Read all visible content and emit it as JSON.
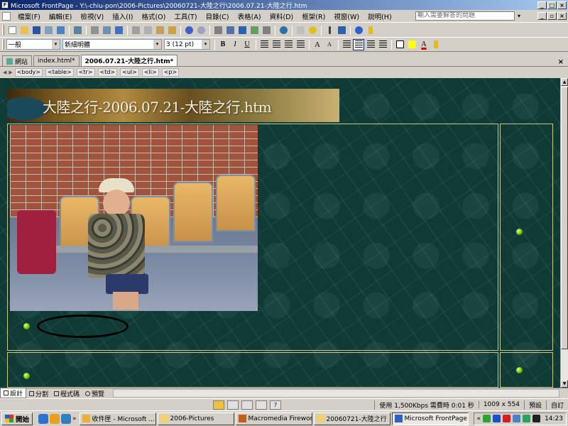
{
  "window": {
    "title": "Microsoft FrontPage - Y:\\-chiu-pon\\2006-Pictures\\20060721-大陸之行\\2006.07.21-大陸之行.htm",
    "app_icon_glyph": "F",
    "min_glyph": "_",
    "max_glyph": "□",
    "close_glyph": "×"
  },
  "menu": {
    "items": [
      "檔案(F)",
      "編輯(E)",
      "檢視(V)",
      "插入(I)",
      "格式(O)",
      "工具(T)",
      "目錄(C)",
      "表格(A)",
      "資料(D)",
      "框架(R)",
      "視窗(W)",
      "說明(H)"
    ],
    "help_placeholder": "輸入需要解答的問題",
    "help_arrow": "▾",
    "doc_min": "_",
    "doc_restore": "▫",
    "doc_close": "×"
  },
  "format": {
    "style": "一般",
    "font": "新細明體",
    "size": "3  (12 pt)",
    "bold": "B",
    "italic": "I",
    "underline": "U",
    "grow_font": "A",
    "shrink_font": "A",
    "font_color": "A",
    "combo_arrow": "▾"
  },
  "tabs": {
    "items": [
      {
        "label": "網站",
        "active": false
      },
      {
        "label": "index.html*",
        "active": false
      },
      {
        "label": "2006.07.21-大陸之行.htm*",
        "active": true
      }
    ],
    "close_glyph": "×"
  },
  "tagbar": {
    "left_arrow": "◀",
    "right_arrow": "▶",
    "tags": [
      "<body>",
      "<table>",
      "<tr>",
      "<td>",
      "<ul>",
      "<li>",
      "<p>"
    ]
  },
  "page": {
    "banner_title": "大陸之行-2006.07.21-大陸之行.htm"
  },
  "scrollbar": {
    "up": "▲",
    "down": "▼"
  },
  "views": {
    "items": [
      {
        "label": "設計",
        "active": true
      },
      {
        "label": "分割",
        "active": false
      },
      {
        "label": "程式碼",
        "active": false
      },
      {
        "label": "預覽",
        "active": false
      }
    ]
  },
  "status": {
    "icon_help": "?",
    "speed": "使用 1,500Kbps 需費時 0:01 秒",
    "dimensions": "1009 x 554",
    "mode": "預設",
    "custom": "自訂"
  },
  "taskbar": {
    "start_label": "開始",
    "overflow": "»",
    "tasks": [
      {
        "label": "收件匣 - Microsoft ...",
        "active": false
      },
      {
        "label": "2006-Pictures",
        "active": false
      },
      {
        "label": "Macromedia Firewor...",
        "active": false
      },
      {
        "label": "20060721-大陸之行",
        "active": false
      },
      {
        "label": "Microsoft FrontPage ...",
        "active": true
      }
    ],
    "tray_arrow": "«",
    "clock": "14:23"
  }
}
